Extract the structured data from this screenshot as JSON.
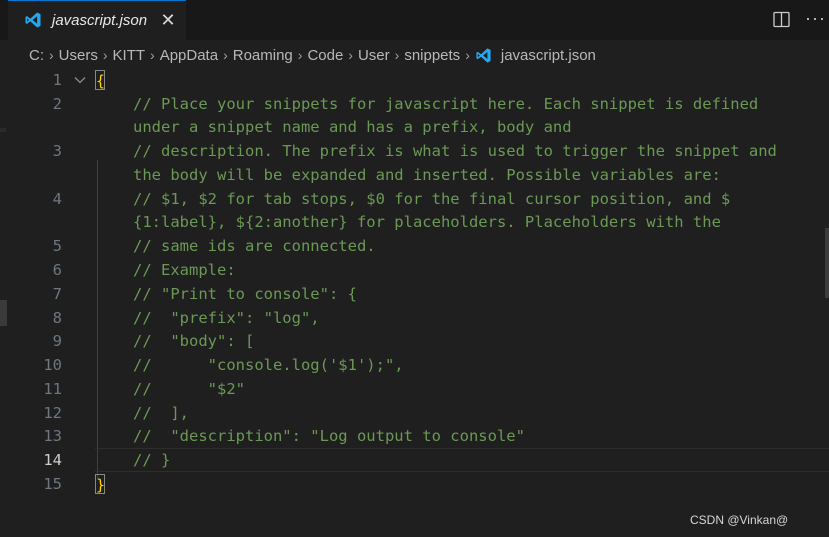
{
  "tab": {
    "label": "javascript.json",
    "close_glyph": "✕",
    "icon": "vscode-icon"
  },
  "toolbar": {
    "split_icon": "split-editor-icon",
    "more_glyph": "···"
  },
  "breadcrumb": {
    "items": [
      "C:",
      "Users",
      "KITT",
      "AppData",
      "Roaming",
      "Code",
      "User",
      "snippets"
    ],
    "file": "javascript.json",
    "separator": "›"
  },
  "editor": {
    "active_line": 14,
    "lines": [
      {
        "n": "1",
        "text": "",
        "brace": "{"
      },
      {
        "n": "2",
        "text": "// Place your snippets for javascript here. Each snippet is defined"
      },
      {
        "n": "",
        "text": "under a snippet name and has a prefix, body and"
      },
      {
        "n": "3",
        "text": "// description. The prefix is what is used to trigger the snippet and"
      },
      {
        "n": "",
        "text": "the body will be expanded and inserted. Possible variables are:"
      },
      {
        "n": "4",
        "text": "// $1, $2 for tab stops, $0 for the final cursor position, and $"
      },
      {
        "n": "",
        "text": "{1:label}, ${2:another} for placeholders. Placeholders with the"
      },
      {
        "n": "5",
        "text": "// same ids are connected."
      },
      {
        "n": "6",
        "text": "// Example:"
      },
      {
        "n": "7",
        "text": "// \"Print to console\": {"
      },
      {
        "n": "8",
        "text": "//  \"prefix\": \"log\","
      },
      {
        "n": "9",
        "text": "//  \"body\": ["
      },
      {
        "n": "10",
        "text": "//      \"console.log('$1');\","
      },
      {
        "n": "11",
        "text": "//      \"$2\""
      },
      {
        "n": "12",
        "text": "//  ],"
      },
      {
        "n": "13",
        "text": "//  \"description\": \"Log output to console\""
      },
      {
        "n": "14",
        "text": "// }"
      },
      {
        "n": "15",
        "text": "",
        "brace": "}"
      }
    ]
  },
  "colors": {
    "comment": "#6a9955",
    "brace": "#ffd700",
    "accent": "#0078d4"
  },
  "watermark": "CSDN @Vinkan@"
}
